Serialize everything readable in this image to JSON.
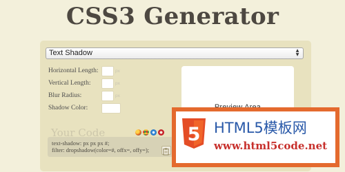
{
  "header": {
    "title": "CSS3 Generator"
  },
  "generator": {
    "selected_effect": "Text Shadow",
    "fields": [
      {
        "label": "Horizontal Length:",
        "unit": "px"
      },
      {
        "label": "Vertical Length:",
        "unit": "px"
      },
      {
        "label": "Blur Radius:",
        "unit": "px"
      },
      {
        "label": "Shadow Color:",
        "unit": ""
      }
    ],
    "preview_text": "Preview Area",
    "your_code_label": "Your Code",
    "browser_icons": [
      "firefox-icon",
      "chrome-icon",
      "safari-icon",
      "opera-icon"
    ],
    "code_lines": [
      "text-shadow: px px px #;",
      "filter: dropshadow(color=#, offx=, offy=);"
    ]
  },
  "watermark": {
    "title": "HTML5模板网",
    "url": "www.html5code.net",
    "badge_text": "5"
  },
  "colors": {
    "page_bg": "#f3f0db",
    "panel_bg": "#e8e2bf",
    "watermark_orange": "#e46a2e",
    "watermark_blue": "#2858a8",
    "watermark_red": "#c7302c"
  }
}
